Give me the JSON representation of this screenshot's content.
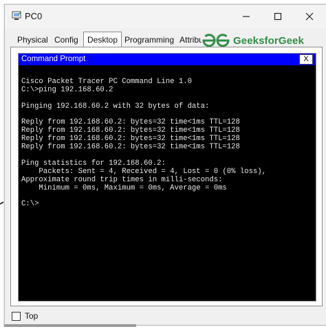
{
  "window": {
    "title": "PC0",
    "controls": {
      "minimize": "minimize-icon",
      "maximize": "maximize-icon",
      "close": "close-icon"
    }
  },
  "tabs": [
    {
      "label": "Physical",
      "active": false
    },
    {
      "label": "Config",
      "active": false
    },
    {
      "label": "Desktop",
      "active": true
    },
    {
      "label": "Programming",
      "active": false
    },
    {
      "label": "Attributes",
      "active": false
    }
  ],
  "watermark": {
    "text": "GeeksforGeek",
    "color": "#2f8d46"
  },
  "command_prompt": {
    "title": "Command Prompt",
    "close_label": "X",
    "lines": [
      "Cisco Packet Tracer PC Command Line 1.0",
      "C:\\>ping 192.168.60.2",
      "",
      "Pinging 192.168.60.2 with 32 bytes of data:",
      "",
      "Reply from 192.168.60.2: bytes=32 time<1ms TTL=128",
      "Reply from 192.168.60.2: bytes=32 time<1ms TTL=128",
      "Reply from 192.168.60.2: bytes=32 time<1ms TTL=128",
      "Reply from 192.168.60.2: bytes=32 time<1ms TTL=128",
      "",
      "Ping statistics for 192.168.60.2:",
      "    Packets: Sent = 4, Received = 4, Lost = 0 (0% loss),",
      "Approximate round trip times in milli-seconds:",
      "    Minimum = 0ms, Maximum = 0ms, Average = 0ms",
      "",
      "C:\\>"
    ]
  },
  "footer": {
    "top_label": "Top",
    "top_checked": false
  }
}
